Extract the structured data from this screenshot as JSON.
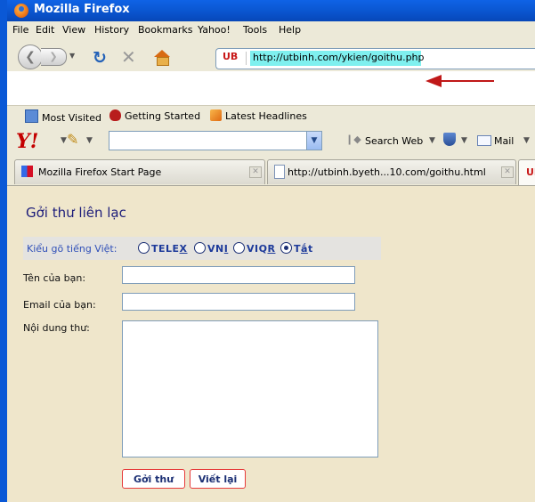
{
  "window": {
    "title": "Mozilla Firefox"
  },
  "menubar": {
    "items": [
      "File",
      "Edit",
      "View",
      "History",
      "Bookmarks",
      "Yahoo!",
      "Tools",
      "Help"
    ]
  },
  "navbar": {
    "site_badge": "UB",
    "url": "http://utbinh.com/ykien/goithu.php"
  },
  "bookmarks": {
    "items": [
      "Most Visited",
      "Getting Started",
      "Latest Headlines"
    ]
  },
  "yahoo_toolbar": {
    "logo": "Y!",
    "search_web": "Search Web",
    "mail": "Mail"
  },
  "tabs": [
    {
      "label": "Mozilla Firefox Start Page"
    },
    {
      "label": "http://utbinh.byeth...10.com/goithu.html"
    },
    {
      "label": "UB",
      "active": true
    }
  ],
  "page": {
    "heading": "Gởi thư liên lạc",
    "typing_mode": {
      "label": "Kiểu gõ tiếng Việt:",
      "options": [
        "TELEX",
        "VNI",
        "VIQR",
        "Tắt"
      ],
      "selected": "Tắt"
    },
    "form": {
      "name_label": "Tên của bạn:",
      "name_value": "",
      "email_label": "Email của bạn:",
      "email_value": "",
      "message_label": "Nội dung thư:",
      "message_value": ""
    },
    "buttons": {
      "send": "Gởi thư",
      "reset": "Viết lại"
    }
  },
  "colors": {
    "titlebar": "#0a55cf",
    "url_highlight": "#7ff0ef",
    "arrow": "#c01818",
    "content_bg": "#efe6cb",
    "heading": "#1d1d7a"
  }
}
